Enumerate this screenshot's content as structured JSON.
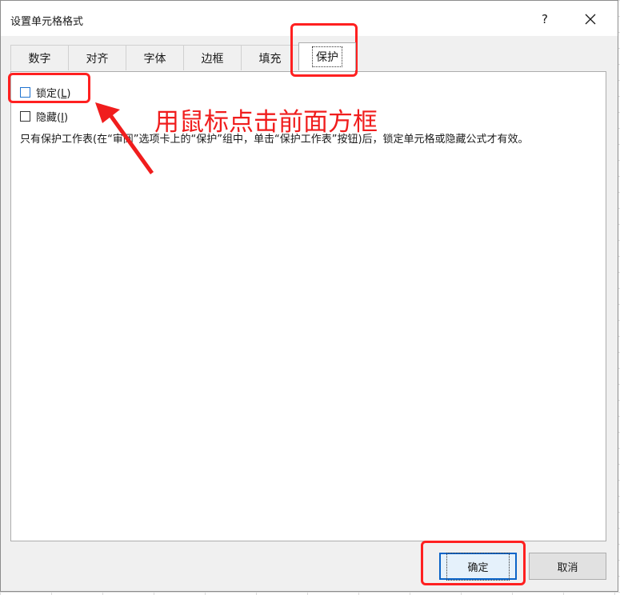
{
  "window": {
    "title": "设置单元格格式",
    "help_label": "?",
    "close_icon": "close-icon"
  },
  "tabs": [
    {
      "label": "数字",
      "active": false
    },
    {
      "label": "对齐",
      "active": false
    },
    {
      "label": "字体",
      "active": false
    },
    {
      "label": "边框",
      "active": false
    },
    {
      "label": "填充",
      "active": false
    },
    {
      "label": "保护",
      "active": true
    }
  ],
  "protection": {
    "locked": {
      "label": "锁定",
      "accel_pre": "(",
      "accel_key": "L",
      "accel_post": ")",
      "checked": false
    },
    "hidden": {
      "label": "隐藏",
      "accel_pre": "(",
      "accel_key": "I",
      "accel_post": ")",
      "checked": false
    },
    "note": "只有保护工作表(在“审阅”选项卡上的“保护”组中，单击“保护工作表”按钮)后，锁定单元格或隐藏公式才有效。"
  },
  "annotation": {
    "text": "用鼠标点击前面方框",
    "color": "#f01d1d"
  },
  "footer": {
    "ok_label": "确定",
    "cancel_label": "取消"
  },
  "colors": {
    "highlight": "#ff2020",
    "focus_blue": "#0a64c8"
  }
}
